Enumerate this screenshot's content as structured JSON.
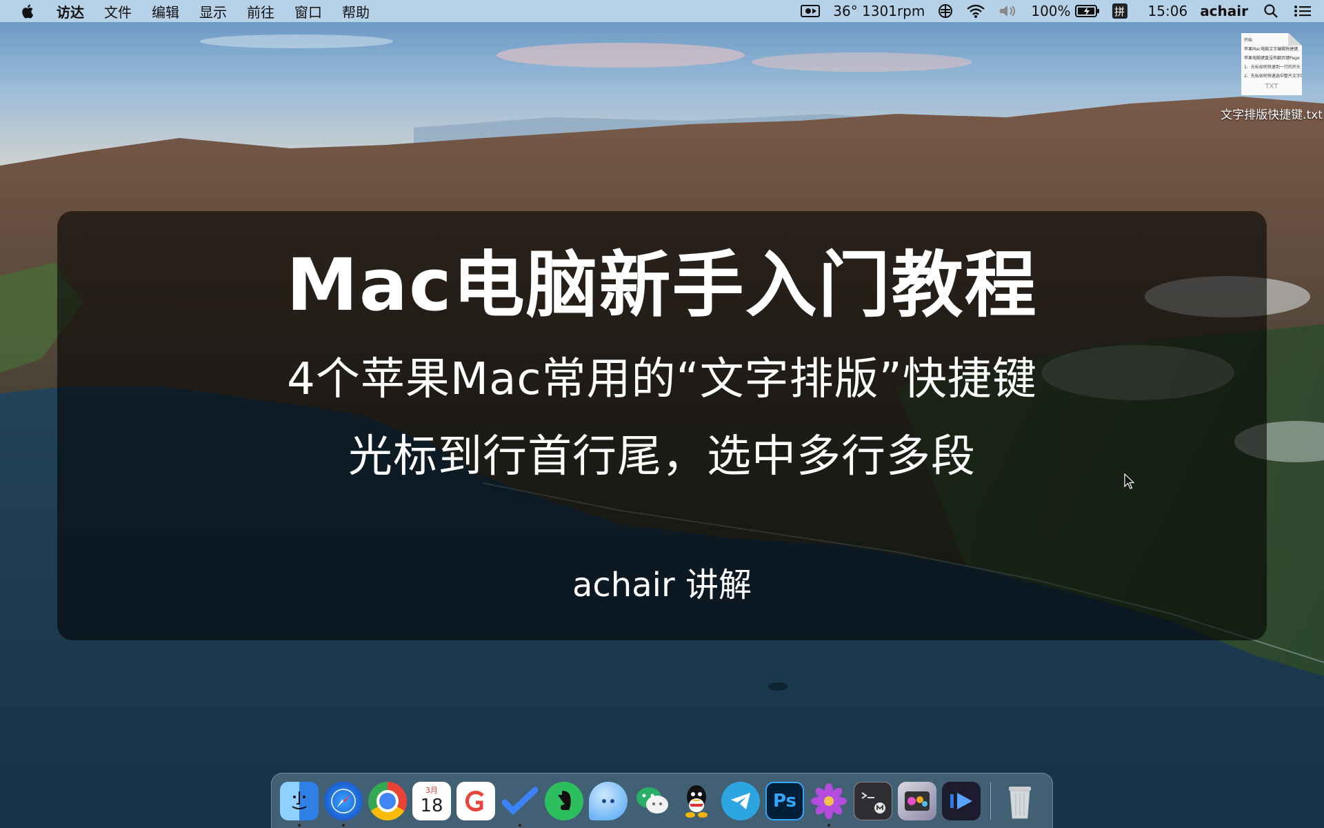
{
  "menubar": {
    "app_name": "访达",
    "items": [
      "文件",
      "编辑",
      "显示",
      "前往",
      "窗口",
      "帮助"
    ],
    "status": {
      "sensor": "36° 1301rpm",
      "battery": "100%",
      "input_method": "拼",
      "time": "15:06",
      "user": "achair"
    },
    "icons": [
      "apple-icon",
      "screen-record-icon",
      "fan-sensor-icon",
      "wifi-icon",
      "volume-icon",
      "battery-charging-icon",
      "search-icon",
      "control-center-icon"
    ]
  },
  "desktop_file": {
    "name": "文字排版快捷键.txt",
    "preview_lines": [
      "开始",
      "苹果Mac电脑文字编辑快捷键,",
      "苹果电脑键盘没有翻页键Page",
      "1、光标如何快速到一行的开头",
      "2、先标如何快速选中整片文字的"
    ],
    "extension_label": "TXT"
  },
  "card": {
    "title": "Mac电脑新手入门教程",
    "subtitle_1": "4个苹果Mac常用的“文字排版”快捷键",
    "subtitle_2": "光标到行首行尾，选中多行多段",
    "author": "achair 讲解"
  },
  "dock": {
    "calendar_month": "3月",
    "calendar_day": "18",
    "photoshop_label": "Ps",
    "apps": [
      {
        "name": "finder",
        "color": "#3a9bf0",
        "running": true
      },
      {
        "name": "safari",
        "color": "#1e7be0",
        "running": true
      },
      {
        "name": "chrome",
        "color": "#e84335",
        "running": false
      },
      {
        "name": "calendar",
        "color": "#ffffff",
        "running": false
      },
      {
        "name": "gitmind",
        "color": "#ffffff",
        "running": false
      },
      {
        "name": "todo",
        "color": "#2f7ae5",
        "running": true
      },
      {
        "name": "evernote",
        "color": "#2dbe60",
        "running": false
      },
      {
        "name": "message",
        "color": "#66b5ff",
        "running": false
      },
      {
        "name": "wechat",
        "color": "#2aae67",
        "running": false
      },
      {
        "name": "qq",
        "color": "#111111",
        "running": false
      },
      {
        "name": "telegram",
        "color": "#2ca5e0",
        "running": false
      },
      {
        "name": "photoshop",
        "color": "#001e36",
        "running": false
      },
      {
        "name": "flower",
        "color": "#b24cd8",
        "running": true
      },
      {
        "name": "terminal",
        "color": "#3a3a3a",
        "running": false
      },
      {
        "name": "motion",
        "color": "#6a5acd",
        "running": false
      },
      {
        "name": "player",
        "color": "#1c1c2e",
        "running": false
      },
      {
        "name": "trash",
        "color": "#e6e6e6",
        "running": false
      }
    ]
  }
}
